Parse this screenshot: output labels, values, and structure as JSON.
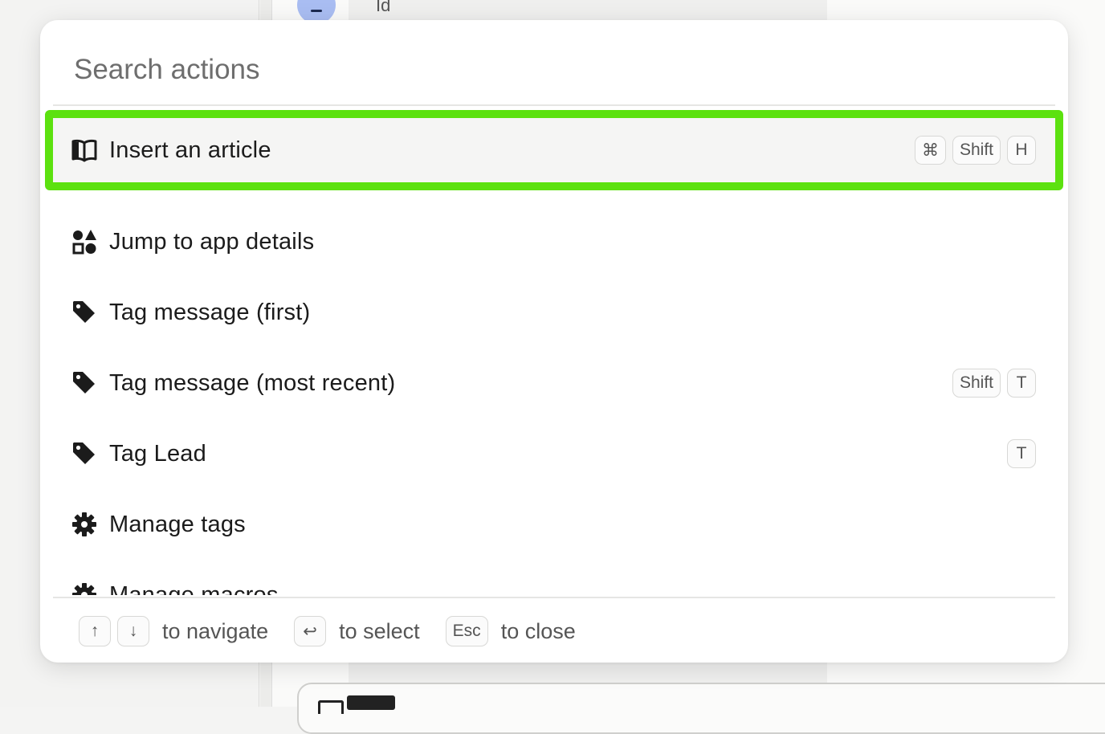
{
  "background": {
    "id_text": "Id"
  },
  "search": {
    "placeholder": "Search actions",
    "value": ""
  },
  "actions": [
    {
      "label": "Insert an article",
      "icon": "book-open-icon",
      "keys": [
        "⌘",
        "Shift",
        "H"
      ],
      "selected": true
    },
    {
      "label": "Jump to app details",
      "icon": "apps-shapes-icon",
      "keys": []
    },
    {
      "label": "Tag message (first)",
      "icon": "tag-icon",
      "keys": []
    },
    {
      "label": "Tag message (most recent)",
      "icon": "tag-icon",
      "keys": [
        "Shift",
        "T"
      ]
    },
    {
      "label": "Tag Lead",
      "icon": "tag-icon",
      "keys": [
        "T"
      ]
    },
    {
      "label": "Manage tags",
      "icon": "gear-icon",
      "keys": []
    },
    {
      "label": "Manage macros",
      "icon": "gear-icon",
      "keys": []
    }
  ],
  "footer": {
    "navigate_hint": "to navigate",
    "select_hint": "to select",
    "close_hint": "to close",
    "up_key": "↑",
    "down_key": "↓",
    "enter_key": "↩",
    "esc_key": "Esc"
  },
  "colors": {
    "selection_outline": "#5ce10f",
    "selected_row_bg": "#f5f5f4",
    "text": "#1b1b1b"
  }
}
